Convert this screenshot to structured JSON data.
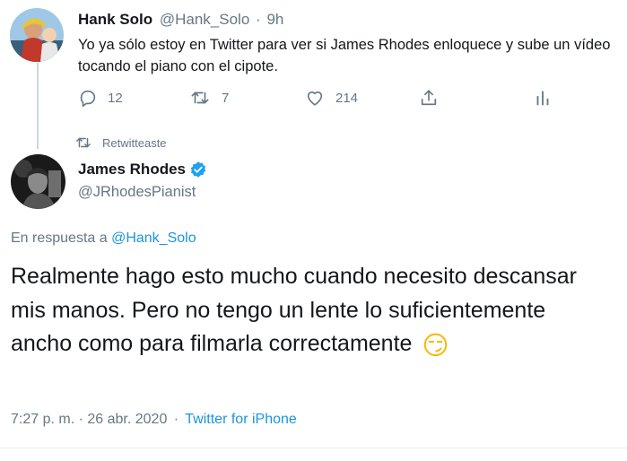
{
  "reply_tweet": {
    "display_name": "Hank Solo",
    "handle": "@Hank_Solo",
    "separator": "·",
    "time": "9h",
    "text": "Yo ya sólo estoy en Twitter para ver si James Rhodes enloquece y sube un vídeo tocando el piano con el cipote.",
    "actions": {
      "reply_count": "12",
      "retweet_count": "7",
      "like_count": "214"
    }
  },
  "retweet_indicator": {
    "label": "Retwitteaste"
  },
  "main_tweet": {
    "display_name": "James Rhodes",
    "handle": "@JRhodesPianist",
    "reply_prefix": "En respuesta a",
    "reply_to": "@Hank_Solo",
    "text": "Realmente hago esto mucho cuando necesito descansar mis manos. Pero no tengo un lente lo suficientemente ancho como para filmarla correctamente",
    "emoji": "😏",
    "timestamp": "7:27 p. m. · 26 abr. 2020",
    "separator": "·",
    "source": "Twitter for iPhone"
  },
  "icons": {
    "reply": "reply-icon",
    "retweet": "retweet-icon",
    "like": "like-icon",
    "share": "share-icon",
    "analytics": "analytics-icon",
    "verified": "verified-badge-icon"
  },
  "colors": {
    "accent": "#1b95e0",
    "verified": "#1da1f2",
    "muted": "#657786",
    "text": "#14171a",
    "thread_line": "#ccd6dd"
  }
}
